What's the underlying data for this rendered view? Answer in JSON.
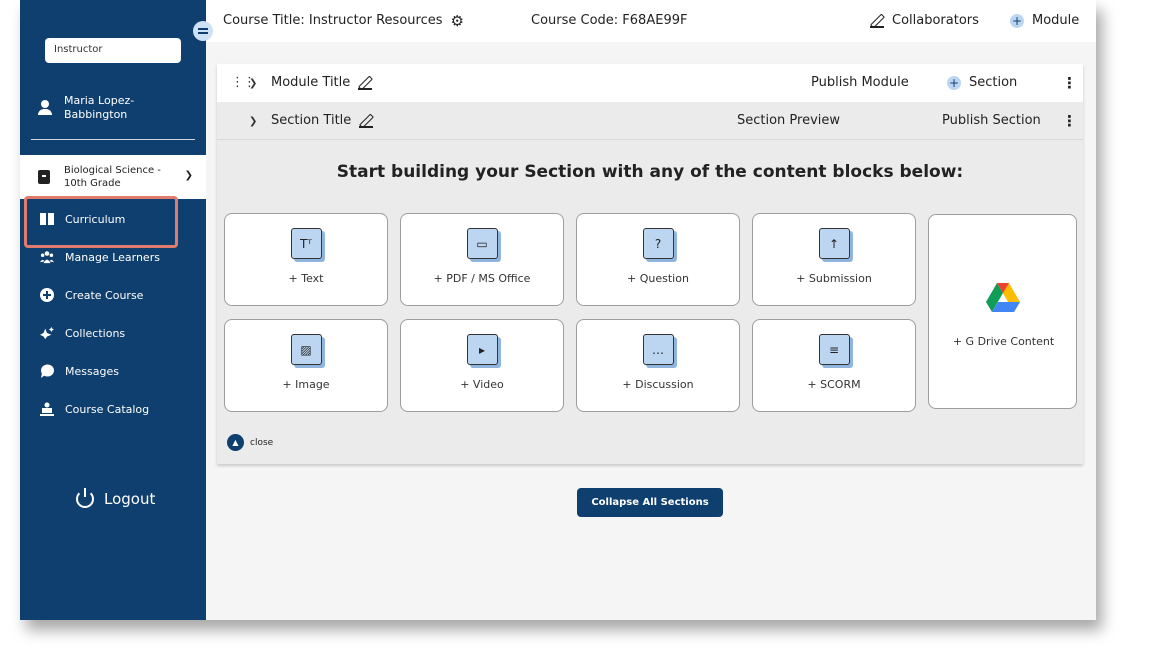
{
  "sidebar": {
    "role_select": "Instructor",
    "user_name": "Maria Lopez-Babbington",
    "course_select": "Biological Science - 10th Grade",
    "nav": [
      {
        "label": "Curriculum",
        "icon": "book-open-icon"
      },
      {
        "label": "Manage Learners",
        "icon": "users-icon"
      },
      {
        "label": "Create Course",
        "icon": "plus-circle-icon"
      },
      {
        "label": "Collections",
        "icon": "sparkles-icon"
      },
      {
        "label": "Messages",
        "icon": "chat-bubble-icon"
      },
      {
        "label": "Course Catalog",
        "icon": "catalog-icon"
      }
    ],
    "logout_label": "Logout"
  },
  "topbar": {
    "course_title": "Course Title: Instructor Resources",
    "course_code": "Course Code: F68AE99F",
    "collaborators_label": "Collaborators",
    "module_label": "Module"
  },
  "module": {
    "title": "Module Title",
    "publish_label": "Publish Module",
    "add_section_label": "Section"
  },
  "section": {
    "title": "Section Title",
    "preview_label": "Section Preview",
    "publish_label": "Publish Section",
    "heading": "Start building your Section with any of the content blocks below:"
  },
  "blocks": [
    {
      "label": "+ Text",
      "icon": "text-icon",
      "glyph": "Tᵀ"
    },
    {
      "label": "+ PDF / MS Office",
      "icon": "folder-icon",
      "glyph": "▭"
    },
    {
      "label": "+ Question",
      "icon": "question-icon",
      "glyph": "?"
    },
    {
      "label": "+ Submission",
      "icon": "upload-cloud-icon",
      "glyph": "↑"
    },
    {
      "label": "+ Image",
      "icon": "image-icon",
      "glyph": "▨"
    },
    {
      "label": "+ Video",
      "icon": "video-icon",
      "glyph": "▸"
    },
    {
      "label": "+ Discussion",
      "icon": "discussion-icon",
      "glyph": "…"
    },
    {
      "label": "+ SCORM",
      "icon": "scorm-icon",
      "glyph": "≡"
    }
  ],
  "gdrive_label": "+ G Drive Content",
  "close_label": "close",
  "collapse_label": "Collapse All Sections",
  "colors": {
    "sidebar": "#0f3f6e",
    "accent": "#bcd6f2",
    "highlight": "#e07b6d"
  }
}
